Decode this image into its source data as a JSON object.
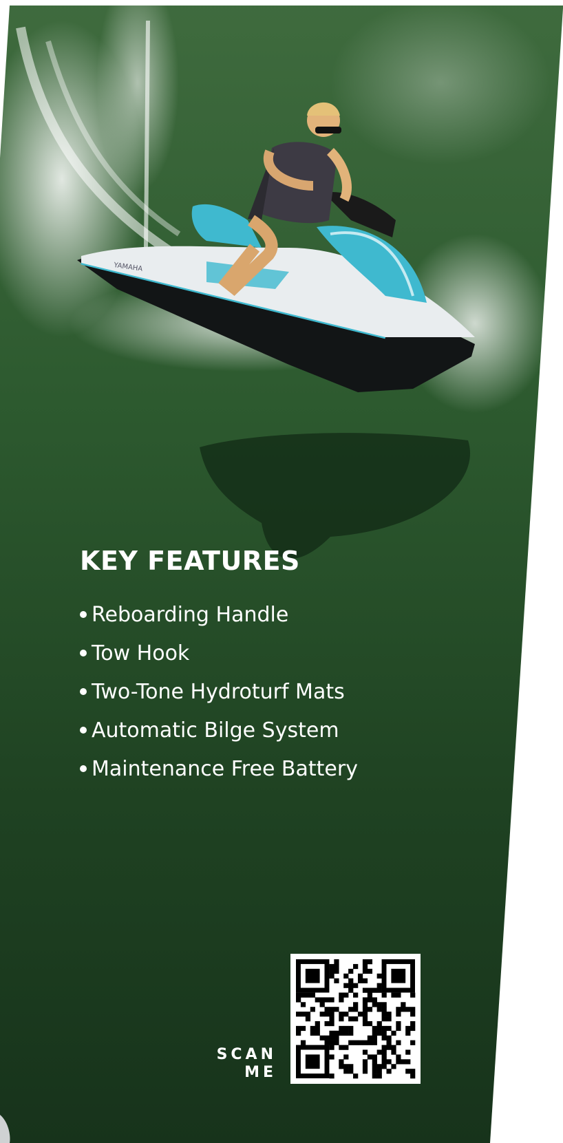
{
  "heading": "KEY FEATURES",
  "features": [
    "Reboarding Handle",
    "Tow Hook",
    "Two-Tone Hydroturf Mats",
    "Automatic Bilge System",
    "Maintenance Free Battery"
  ],
  "brand_on_hull": "YAMAHA",
  "scan": {
    "line1": "SCAN",
    "line2": "ME"
  },
  "colors": {
    "water_top": "#3f6b3e",
    "water_bottom": "#17331b",
    "hull_white": "#e9edef",
    "hull_teal": "#3fb9cf",
    "hull_black": "#121516"
  }
}
